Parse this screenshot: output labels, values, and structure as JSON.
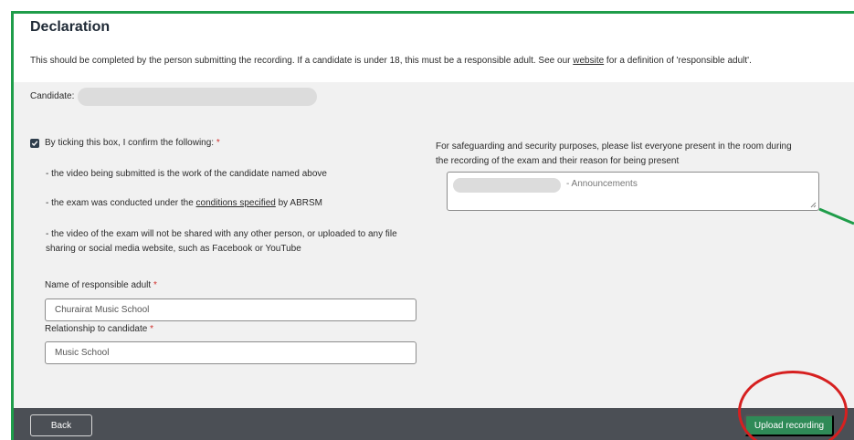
{
  "colors": {
    "frame": "#1f9d4a",
    "panel": "#f1f1f1",
    "footer": "#4b4f55",
    "upload_button": "#2f8a57",
    "required": "#d0312d",
    "annotation_circle": "#d62020"
  },
  "declaration": {
    "title": "Declaration",
    "intro_before_link": "This should be completed by the person submitting the recording. If a candidate is under 18, this must be a responsible adult. See our ",
    "intro_link": "website",
    "intro_after_link": " for a definition of 'responsible adult'."
  },
  "candidate": {
    "label": "Candidate:"
  },
  "confirm": {
    "checked": true,
    "label": "By ticking this box, I confirm the following:",
    "required_mark": "*",
    "bullet_1": "- the video being submitted is the work of the candidate named above",
    "bullet_2_before": "- the exam was conducted under the ",
    "bullet_2_link": "conditions specified",
    "bullet_2_after": " by ABRSM",
    "bullet_3_line1": "- the video of the exam will not be shared with any other person, or uploaded to any file",
    "bullet_3_line2": "sharing or social media website, such as Facebook or YouTube"
  },
  "responsible_adult": {
    "label": "Name of responsible adult",
    "required_mark": "*",
    "value": "Churairat Music School"
  },
  "relationship": {
    "label": "Relationship to candidate",
    "required_mark": "*",
    "value": "Music School"
  },
  "safeguarding": {
    "prompt_line1": "For safeguarding and security purposes, please list everyone present in the room during",
    "prompt_line2": "the recording of the exam and their reason for being present",
    "value_suffix": "- Announcements"
  },
  "footer": {
    "back_label": "Back",
    "upload_label": "Upload recording"
  }
}
